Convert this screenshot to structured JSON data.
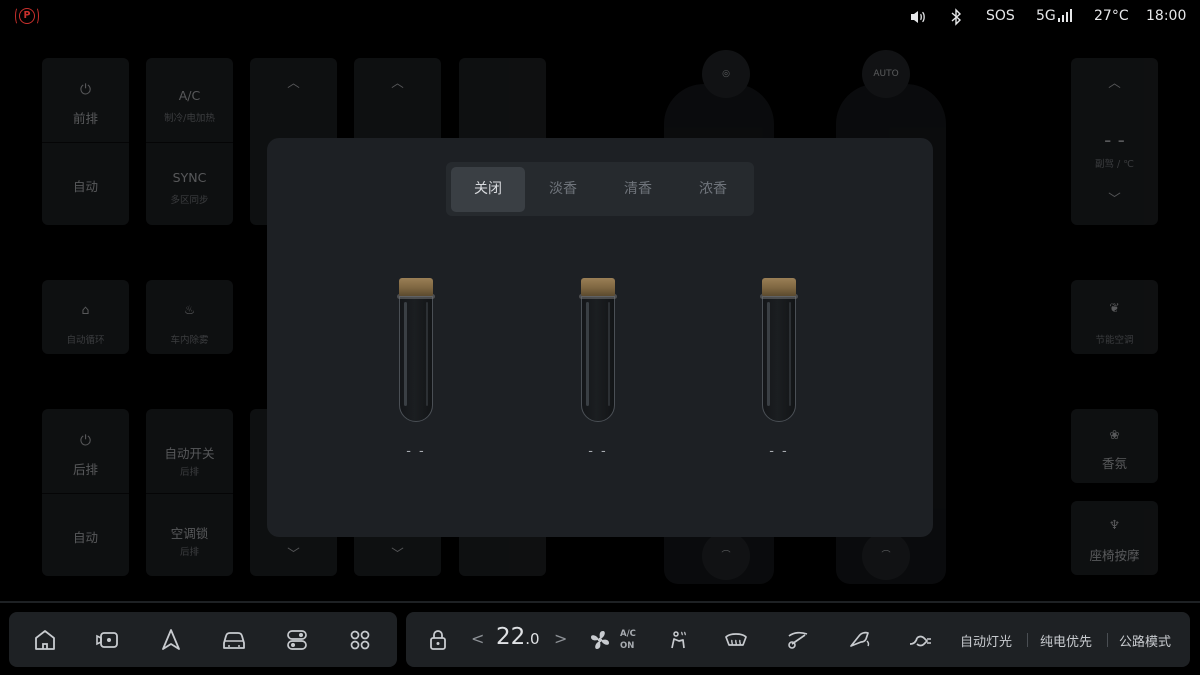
{
  "status_bar": {
    "park_symbol": "P",
    "sos": "SOS",
    "network": "5G",
    "temperature": "27°C",
    "time": "18:00"
  },
  "background_controls": {
    "front_power": "前排",
    "front_auto": "自动",
    "ac": "A/C",
    "ac_sub": "制冷/电加热",
    "sync": "SYNC",
    "sync_sub": "多区同步",
    "auto_recirc": "自动循环",
    "cabin_purify": "车内除雾",
    "rear_power": "后排",
    "rear_auto": "自动",
    "auto_switch": "自动开关",
    "auto_switch_sub": "后排",
    "ac_lock": "空调锁",
    "ac_lock_sub": "后排",
    "right_temp": "- -",
    "right_temp_unit": "副驾 / ℃",
    "eco_ac": "节能空调",
    "fragrance": "香氛",
    "seat_massage": "座椅按摩",
    "auto_badge": "AUTO"
  },
  "fragrance_modal": {
    "tabs": [
      {
        "label": "关闭",
        "active": true
      },
      {
        "label": "淡香",
        "active": false
      },
      {
        "label": "清香",
        "active": false
      },
      {
        "label": "浓香",
        "active": false
      }
    ],
    "bottles": [
      {
        "label": "- -"
      },
      {
        "label": "- -"
      },
      {
        "label": "- -"
      }
    ]
  },
  "dock": {
    "temperature_main": "22",
    "temperature_decimal": ".0",
    "ac_label_top": "A/C",
    "ac_label_bottom": "ON",
    "auto_light": "自动灯光",
    "ev_priority": "纯电优先",
    "road_mode": "公路模式"
  },
  "icons": [
    "park-brake-icon",
    "volume-icon",
    "bluetooth-icon",
    "signal-icon",
    "home-icon",
    "camera-icon",
    "navigation-icon",
    "car-icon",
    "toggle-icon",
    "apps-icon",
    "lock-icon",
    "fan-icon",
    "seat-heat-icon",
    "defrost-icon",
    "wiper-icon",
    "mirror-icon",
    "headlight-icon"
  ]
}
